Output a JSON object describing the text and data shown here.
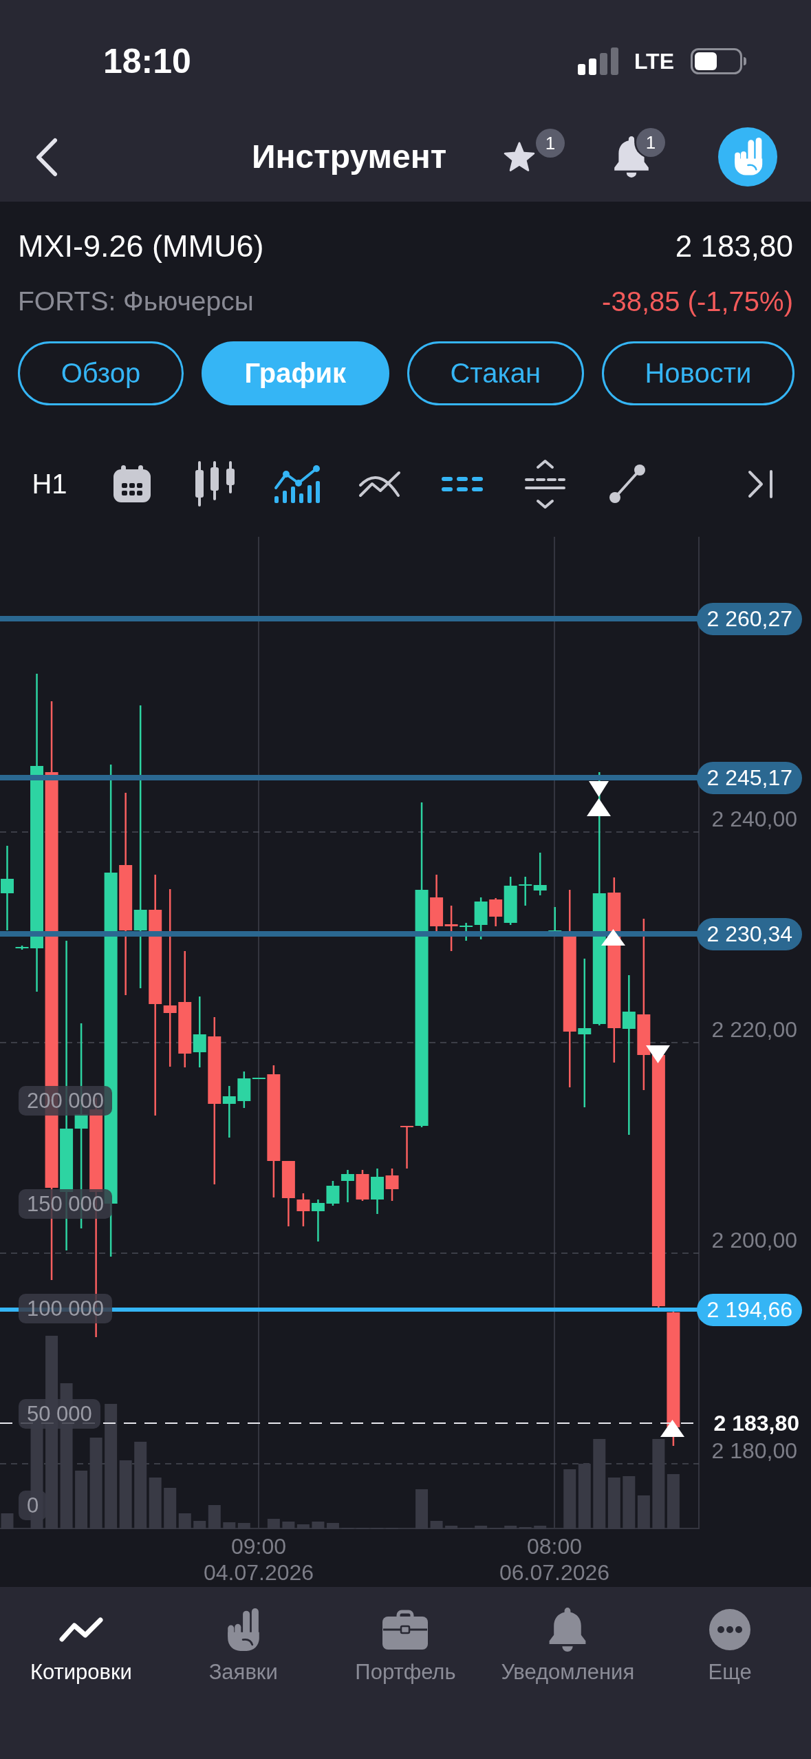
{
  "status_bar": {
    "time": "18:10",
    "network": "LTE"
  },
  "nav_bar": {
    "title": "Инструмент",
    "favorites_badge": "1",
    "notifications_badge": "1"
  },
  "instrument": {
    "name": "MXI-9.26 (MMU6)",
    "price": "2 183,80",
    "market": "FORTS: Фьючерсы",
    "change": "-38,85 (-1,75%)"
  },
  "tabs": [
    {
      "label": "Обзор",
      "selected": false
    },
    {
      "label": "График",
      "selected": true
    },
    {
      "label": "Стакан",
      "selected": false
    },
    {
      "label": "Новости",
      "selected": false
    }
  ],
  "chart_toolbar": {
    "timeframe": "H1",
    "tools": [
      {
        "kind": "calendar",
        "on": false
      },
      {
        "kind": "candles",
        "on": false
      },
      {
        "kind": "indicators",
        "on": true
      },
      {
        "kind": "trend",
        "on": false
      },
      {
        "kind": "levels",
        "on": true
      },
      {
        "kind": "range",
        "on": false
      },
      {
        "kind": "line",
        "on": false
      },
      {
        "kind": "scroll_end",
        "on": false
      }
    ]
  },
  "chart": {
    "price_levels": [
      {
        "label": "2 260,27",
        "kind": "level"
      },
      {
        "label": "2 245,17",
        "kind": "level"
      },
      {
        "label": "2 230,34",
        "kind": "level"
      },
      {
        "label": "2 194,66",
        "kind": "order"
      },
      {
        "label": "2 183,80",
        "kind": "last"
      }
    ],
    "price_axis": [
      "2 240,00",
      "2 220,00",
      "2 200,00",
      "2 180,00"
    ],
    "volume_axis": [
      "200 000",
      "150 000",
      "100 000",
      "50 000",
      "0"
    ],
    "time_axis": [
      {
        "time": "09:00",
        "date": "04.07.2026"
      },
      {
        "time": "08:00",
        "date": "06.07.2026"
      }
    ]
  },
  "bottom_nav": [
    {
      "label": "Котировки",
      "kind": "quotes",
      "selected": true
    },
    {
      "label": "Заявки",
      "kind": "orders",
      "selected": false
    },
    {
      "label": "Портфель",
      "kind": "portfolio",
      "selected": false
    },
    {
      "label": "Уведомления",
      "kind": "alerts",
      "selected": false
    },
    {
      "label": "Еще",
      "kind": "more",
      "selected": false
    }
  ]
}
